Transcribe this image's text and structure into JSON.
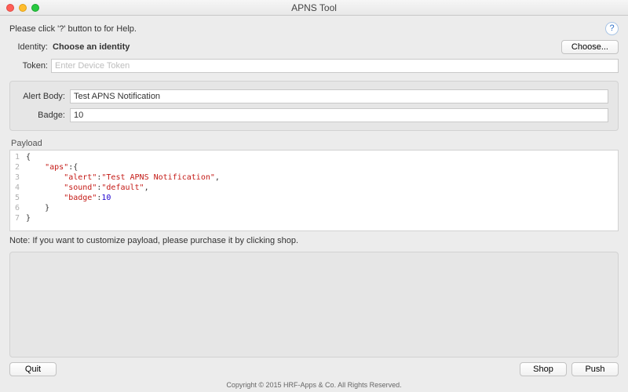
{
  "window": {
    "title": "APNS Tool"
  },
  "help_row": {
    "text": "Please click '?' button to for Help."
  },
  "identity": {
    "label": "Identity:",
    "value": "Choose an identity",
    "choose_btn": "Choose..."
  },
  "token": {
    "label": "Token:",
    "placeholder": "Enter Device Token",
    "value": ""
  },
  "form": {
    "alert_label": "Alert Body:",
    "alert_value": "Test APNS Notification",
    "badge_label": "Badge:",
    "badge_value": "10"
  },
  "payload": {
    "legend": "Payload",
    "lines": [
      {
        "n": 1,
        "plain": "{"
      },
      {
        "n": 2,
        "indent": "    ",
        "key": "\"aps\"",
        "after": ":{"
      },
      {
        "n": 3,
        "indent": "        ",
        "key": "\"alert\"",
        "mid": ":",
        "val_str": "\"Test APNS Notification\"",
        "after": ","
      },
      {
        "n": 4,
        "indent": "        ",
        "key": "\"sound\"",
        "mid": ":",
        "val_str": "\"default\"",
        "after": ","
      },
      {
        "n": 5,
        "indent": "        ",
        "key": "\"badge\"",
        "mid": ":",
        "val_num": "10"
      },
      {
        "n": 6,
        "indent": "    ",
        "plain": "}"
      },
      {
        "n": 7,
        "plain": "}"
      }
    ]
  },
  "note": "Note: If you want to customize payload, please purchase it by clicking shop.",
  "buttons": {
    "quit": "Quit",
    "shop": "Shop",
    "push": "Push"
  },
  "copyright": "Copyright © 2015 HRF-Apps & Co. All Rights Reserved."
}
